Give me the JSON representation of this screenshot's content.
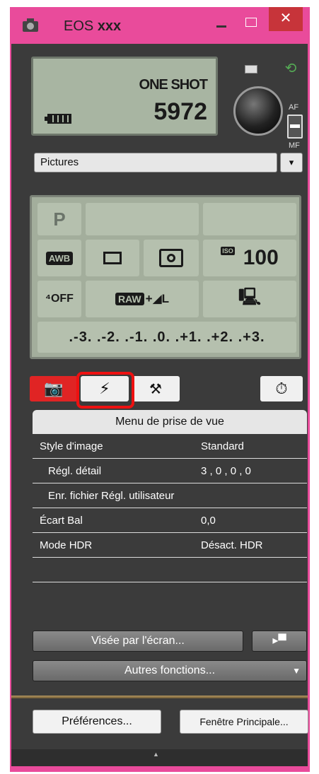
{
  "window": {
    "title_prefix": "EOS",
    "title_model": "xxx",
    "close_glyph": "✕"
  },
  "status": {
    "shooting_mode": "ONE SHOT",
    "shots_remaining": "5972",
    "af_label": "AF",
    "mf_label": "MF"
  },
  "folder": {
    "name": "Pictures",
    "button_glyph": "▾"
  },
  "settings": {
    "mode": "P",
    "white_balance": "AWB",
    "iso_badge": "ISO",
    "iso": "100",
    "aeb": "⁴OFF",
    "quality_raw": "RAW",
    "quality_jpeg": "+◢L",
    "exposure_scale": ".-3. .-2. .-1. .0. .+1. .+2. .+3."
  },
  "tabs": {
    "shoot_glyph": "📷",
    "flash_glyph": "⚡",
    "tools_glyph": "⚒",
    "timer_glyph": "⏱"
  },
  "menu": {
    "header": "Menu de prise de vue",
    "rows": [
      {
        "label": "Style d'image",
        "value": "Standard"
      },
      {
        "label": "Régl. détail",
        "value": "3 , 0 , 0 , 0"
      },
      {
        "label": "Enr. fichier Régl. utilisateur",
        "value": ""
      },
      {
        "label": "Écart Bal",
        "value": "0,0"
      },
      {
        "label": "Mode HDR",
        "value": "Désact. HDR"
      }
    ]
  },
  "buttons": {
    "live_view": "Visée par l'écran...",
    "movie_glyph": "▸▀",
    "other_functions": "Autres fonctions...",
    "other_arrow": "▼",
    "preferences": "Préférences...",
    "main_window": "Fenêtre Principale..."
  },
  "footer": {
    "collapse_glyph": "▲"
  }
}
